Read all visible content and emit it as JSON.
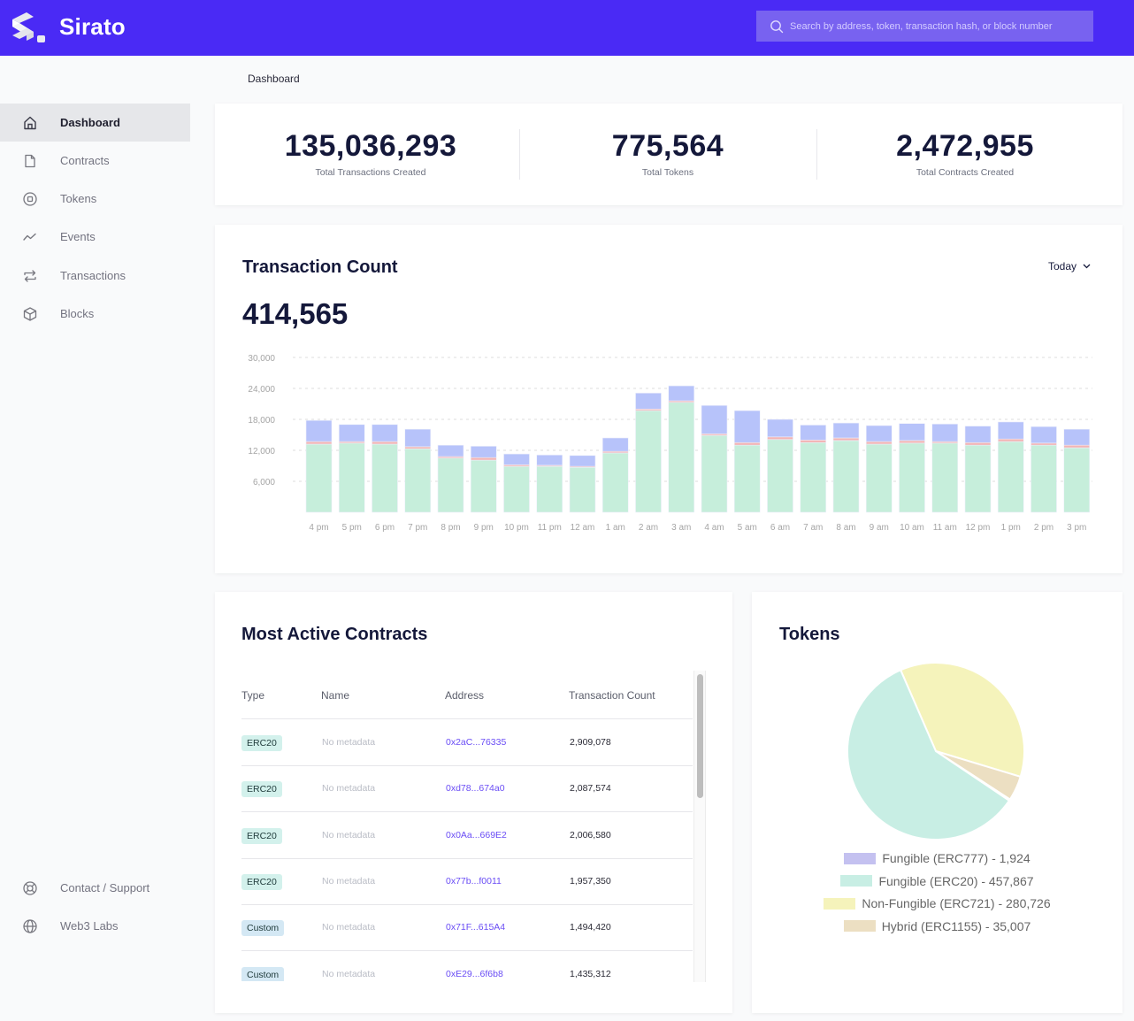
{
  "app": {
    "brand": "Sirato",
    "search_placeholder": "Search by address, token, transaction hash, or block number"
  },
  "sidebar": {
    "items": [
      {
        "label": "Dashboard",
        "icon": "home-icon",
        "active": true
      },
      {
        "label": "Contracts",
        "icon": "document-icon",
        "active": false
      },
      {
        "label": "Tokens",
        "icon": "token-icon",
        "active": false
      },
      {
        "label": "Events",
        "icon": "trend-line-icon",
        "active": false
      },
      {
        "label": "Transactions",
        "icon": "arrows-swap-icon",
        "active": false
      },
      {
        "label": "Blocks",
        "icon": "cube-icon",
        "active": false
      }
    ],
    "footer_items": [
      {
        "label": "Contact / Support",
        "icon": "lifebuoy-icon"
      },
      {
        "label": "Web3 Labs",
        "icon": "globe-icon"
      }
    ]
  },
  "breadcrumb": "Dashboard",
  "stats": [
    {
      "value": "135,036,293",
      "label": "Total Transactions Created"
    },
    {
      "value": "775,564",
      "label": "Total Tokens"
    },
    {
      "value": "2,472,955",
      "label": "Total Contracts Created"
    }
  ],
  "transaction_count": {
    "title": "Transaction Count",
    "total": "414,565",
    "range_selected": "Today"
  },
  "chart_data": [
    {
      "type": "bar",
      "stacked": true,
      "title": "Transaction Count",
      "xlabel": "",
      "ylabel": "",
      "ylim": [
        0,
        30000
      ],
      "yticks": [
        6000,
        12000,
        18000,
        24000,
        30000
      ],
      "ytick_labels": [
        "6,000",
        "12,000",
        "18,000",
        "24,000",
        "30,000"
      ],
      "grid": true,
      "categories": [
        "4 pm",
        "5 pm",
        "6 pm",
        "7 pm",
        "8 pm",
        "9 pm",
        "10 pm",
        "11 pm",
        "12 am",
        "1 am",
        "2 am",
        "3 am",
        "4 am",
        "5 am",
        "6 am",
        "7 am",
        "8 am",
        "9 am",
        "10 am",
        "11 am",
        "12 pm",
        "1 pm",
        "2 pm",
        "3 pm"
      ],
      "series": [
        {
          "name": "series-green",
          "color": "#c6eedb",
          "values": [
            13200,
            13400,
            13200,
            12300,
            10500,
            10100,
            8900,
            8900,
            8700,
            11500,
            19700,
            21300,
            14900,
            13000,
            14100,
            13500,
            13900,
            13200,
            13400,
            13400,
            13000,
            13700,
            13000,
            12500
          ]
        },
        {
          "name": "series-red",
          "color": "#f2b5b5",
          "values": [
            500,
            300,
            500,
            400,
            300,
            500,
            300,
            200,
            200,
            300,
            300,
            300,
            300,
            500,
            500,
            500,
            500,
            500,
            500,
            300,
            500,
            500,
            400,
            500
          ]
        },
        {
          "name": "series-blue",
          "color": "#b7c3fa",
          "values": [
            4100,
            3300,
            3300,
            3400,
            2200,
            2200,
            2100,
            2000,
            2100,
            2600,
            3100,
            2900,
            5500,
            6200,
            3400,
            2900,
            2900,
            3100,
            3300,
            3400,
            3200,
            3300,
            3200,
            3100
          ]
        }
      ]
    },
    {
      "type": "pie",
      "title": "Tokens",
      "legend_position": "bottom",
      "slices": [
        {
          "label": "Fungible (ERC777)",
          "value": 1924,
          "display": "1,924",
          "color": "#c4c1f0"
        },
        {
          "label": "Fungible (ERC20)",
          "value": 457867,
          "display": "457,867",
          "color": "#c8eee4"
        },
        {
          "label": "Non-Fungible (ERC721)",
          "value": 280726,
          "display": "280,726",
          "color": "#f5f3bb"
        },
        {
          "label": "Hybrid (ERC1155)",
          "value": 35007,
          "display": "35,007",
          "color": "#ecdfc2"
        }
      ]
    }
  ],
  "most_active_contracts": {
    "title": "Most Active Contracts",
    "columns": [
      "Type",
      "Name",
      "Address",
      "Transaction Count"
    ],
    "rows": [
      {
        "type": "ERC20",
        "name": "No metadata",
        "address": "0x2aC...76335",
        "count": "2,909,078"
      },
      {
        "type": "ERC20",
        "name": "No metadata",
        "address": "0xd78...674a0",
        "count": "2,087,574"
      },
      {
        "type": "ERC20",
        "name": "No metadata",
        "address": "0x0Aa...669E2",
        "count": "2,006,580"
      },
      {
        "type": "ERC20",
        "name": "No metadata",
        "address": "0x77b...f0011",
        "count": "1,957,350"
      },
      {
        "type": "Custom",
        "name": "No metadata",
        "address": "0x71F...615A4",
        "count": "1,494,420"
      },
      {
        "type": "Custom",
        "name": "No metadata",
        "address": "0xE29...6f6b8",
        "count": "1,435,312"
      }
    ],
    "badge_colors": {
      "ERC20": "#d3f1ec",
      "Custom": "#d4e8f4"
    }
  },
  "tokens_card": {
    "title": "Tokens"
  },
  "colors": {
    "brand": "#4a2af5",
    "search_bg": "#7862f0",
    "link": "#6a4df5"
  }
}
